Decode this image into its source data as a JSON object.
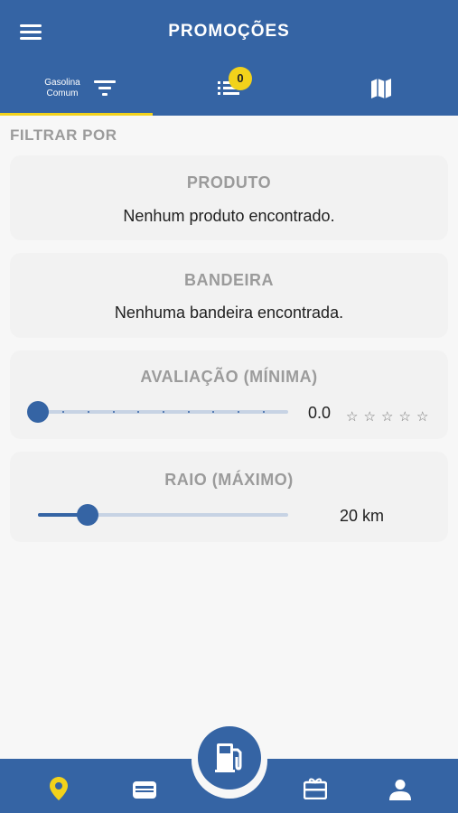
{
  "header": {
    "title": "PROMOÇÕES",
    "menu_icon": "hamburger-menu-icon"
  },
  "tabs": {
    "fuel_label": "Gasolina Comum",
    "filter_icon": "filter-icon",
    "list_icon": "list-icon",
    "list_badge": "0",
    "map_icon": "map-icon"
  },
  "filter": {
    "section_title": "FILTRAR POR",
    "product": {
      "title": "PRODUTO",
      "empty_text": "Nenhum produto encontrado."
    },
    "brand": {
      "title": "BANDEIRA",
      "empty_text": "Nenhuma bandeira encontrada."
    },
    "rating": {
      "title": "AVALIAÇÃO (MÍNIMA)",
      "value_text": "0.0",
      "value": 0,
      "max": 5,
      "stars": [
        "☆",
        "☆",
        "☆",
        "☆",
        "☆"
      ]
    },
    "radius": {
      "title": "RAIO (MÁXIMO)",
      "value_text": "20 km",
      "fraction": 0.2
    }
  },
  "bottom_nav": {
    "items": [
      "location-pin-icon",
      "wallet-icon",
      "gas-pump-icon",
      "gift-card-icon",
      "user-icon"
    ],
    "active": "location-pin-icon"
  },
  "colors": {
    "primary": "#3564a4",
    "accent": "#f2d21b",
    "background": "#f7f7f7",
    "card": "#f2f2f2",
    "muted_text": "#9b9b9b"
  }
}
